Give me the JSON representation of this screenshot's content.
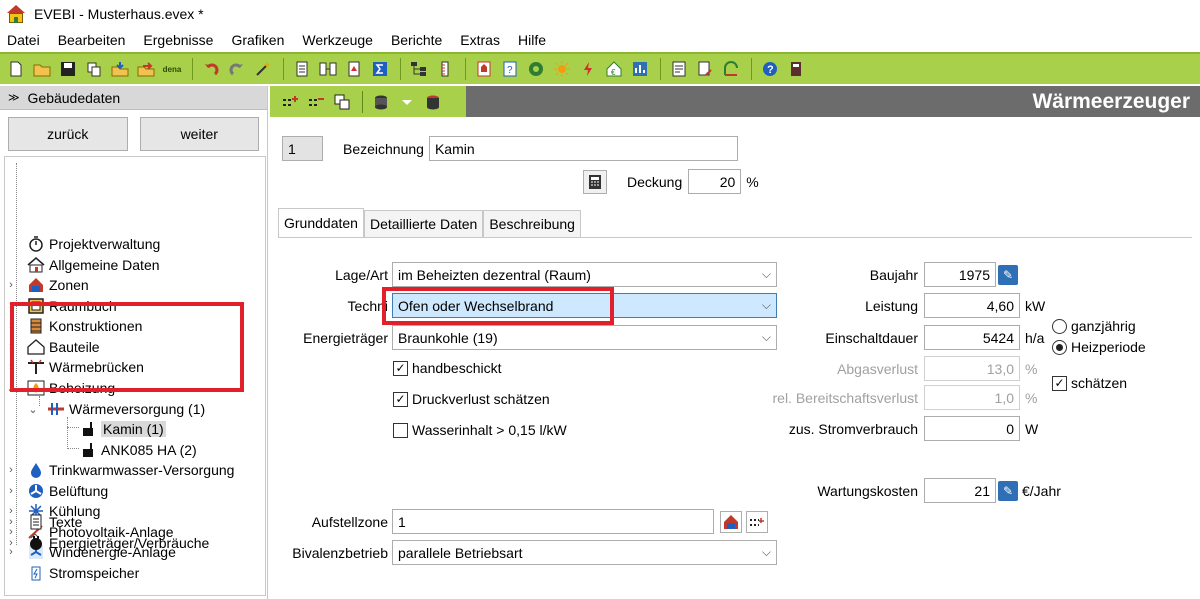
{
  "window": {
    "title": "EVEBI - Musterhaus.evex *"
  },
  "menu": [
    "Datei",
    "Bearbeiten",
    "Ergebnisse",
    "Grafiken",
    "Werkzeuge",
    "Berichte",
    "Extras",
    "Hilfe"
  ],
  "toolbar": {
    "dena_label": "dena"
  },
  "left_panel": {
    "header": "Gebäudedaten",
    "back_button": "zurück",
    "forward_button": "weiter",
    "tree": [
      {
        "label": "Projektverwaltung",
        "icon": "stopwatch-icon"
      },
      {
        "label": "Allgemeine Daten",
        "icon": "house-icon"
      },
      {
        "label": "Zonen",
        "icon": "zones-icon"
      },
      {
        "label": "Raumbuch",
        "icon": "room-book-icon"
      },
      {
        "label": "Konstruktionen",
        "icon": "construction-icon"
      },
      {
        "label": "Bauteile",
        "icon": "building-part-icon"
      },
      {
        "label": "Wärmebrücken",
        "icon": "thermal-bridge-icon"
      },
      {
        "label": "Beheizung",
        "icon": "flame-icon"
      },
      {
        "label": "Wärmeversorgung (1)",
        "icon": "heat-supply-icon"
      },
      {
        "label": "Kamin (1)",
        "icon": "stove-icon"
      },
      {
        "label": "ANK085 HA (2)",
        "icon": "stove-icon"
      },
      {
        "label": "Trinkwarmwasser-Versorgung",
        "icon": "water-drop-icon"
      },
      {
        "label": "Belüftung",
        "icon": "fan-icon"
      },
      {
        "label": "Kühlung",
        "icon": "snowflake-icon"
      },
      {
        "label": "Photovoltaik-Anlage",
        "icon": "photovoltaic-icon"
      },
      {
        "label": "Windenergie-Anlage",
        "icon": "wind-icon"
      },
      {
        "label": "Stromspeicher",
        "icon": "battery-icon"
      },
      {
        "label": "Texte",
        "icon": "document-icon"
      },
      {
        "label": "Energieträger/Verbräuche",
        "icon": "plug-icon"
      }
    ]
  },
  "right_panel": {
    "title": "Wärmeerzeuger",
    "index": "1",
    "bezeichnung_label": "Bezeichnung",
    "bezeichnung_value": "Kamin",
    "deckung_label": "Deckung",
    "deckung_value": "20",
    "deckung_unit": "%",
    "tabs": [
      "Grunddaten",
      "Detaillierte Daten",
      "Beschreibung"
    ],
    "lage_label": "Lage/Art",
    "lage_value": "im Beheizten dezentral (Raum)",
    "technik_label": "Techni",
    "technik_value": "Ofen oder Wechselbrand",
    "energietraeger_label": "Energieträger",
    "energietraeger_value": "Braunkohle (19)",
    "chk_handbeschickt": "handbeschickt",
    "chk_druckverlust": "Druckverlust schätzen",
    "chk_wasserinhalt": "Wasserinhalt > 0,15 l/kW",
    "baujahr_label": "Baujahr",
    "baujahr_value": "1975",
    "leistung_label": "Leistung",
    "leistung_value": "4,60",
    "leistung_unit": "kW",
    "einschaltdauer_label": "Einschaltdauer",
    "einschaltdauer_value": "5424",
    "einschaltdauer_unit": "h/a",
    "radio_ganzjaehrig": "ganzjährig",
    "radio_heizperiode": "Heizperiode",
    "abgasverlust_label": "Abgasverlust",
    "abgasverlust_value": "13,0",
    "abgasverlust_unit": "%",
    "bereitschaft_label": "rel. Bereitschaftsverlust",
    "bereitschaft_value": "1,0",
    "bereitschaft_unit": "%",
    "chk_schaetzen": "schätzen",
    "strom_label": "zus. Stromverbrauch",
    "strom_value": "0",
    "strom_unit": "W",
    "wartung_label": "Wartungskosten",
    "wartung_value": "21",
    "wartung_unit": "€/Jahr",
    "aufstellzone_label": "Aufstellzone",
    "aufstellzone_value": "1",
    "bivalenz_label": "Bivalenzbetrieb",
    "bivalenz_value": "parallele Betriebsart"
  }
}
